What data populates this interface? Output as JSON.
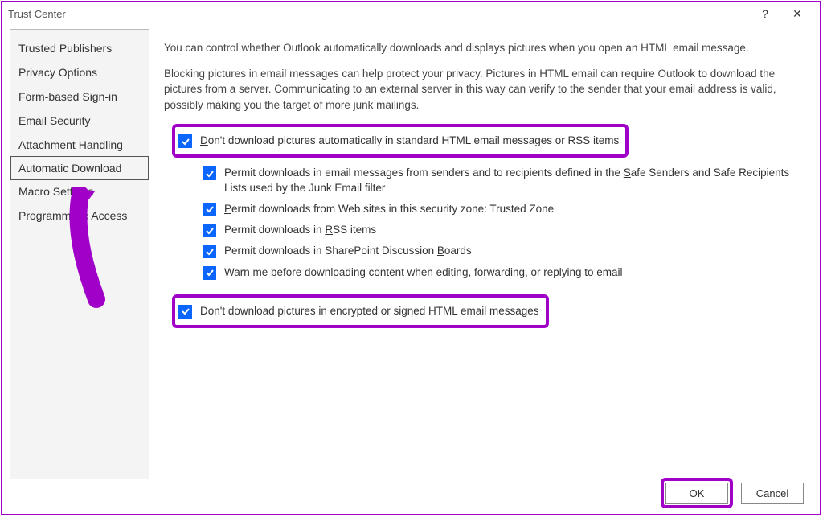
{
  "titlebar": {
    "title": "Trust Center",
    "help": "?",
    "close": "✕"
  },
  "sidebar": {
    "items": [
      {
        "label": "Trusted Publishers"
      },
      {
        "label": "Privacy Options"
      },
      {
        "label": "Form-based Sign-in"
      },
      {
        "label": "Email Security"
      },
      {
        "label": "Attachment Handling"
      },
      {
        "label": "Automatic Download"
      },
      {
        "label": "Macro Settings"
      },
      {
        "label": "Programmatic Access"
      }
    ],
    "selected_index": 5
  },
  "content": {
    "para1": "You can control whether Outlook automatically downloads and displays pictures when you open an HTML email message.",
    "para2": "Blocking pictures in email messages can help protect your privacy. Pictures in HTML email can require Outlook to download the pictures from a server. Communicating to an external server in this way can verify to the sender that your email address is valid, possibly making you the target of more junk mailings.",
    "chk_main": {
      "pre": "D",
      "post": "on't download pictures automatically in standard HTML email messages or RSS items",
      "checked": true
    },
    "sub": [
      {
        "pre": "Permit downloads in email messages from senders and to recipients defined in the ",
        "u": "S",
        "post": "afe Senders and Safe Recipients Lists used by the Junk Email filter",
        "checked": true
      },
      {
        "pre": "",
        "u": "P",
        "post": "ermit downloads from Web sites in this security zone: Trusted Zone",
        "checked": true
      },
      {
        "pre": "Permit downloads in ",
        "u": "R",
        "post": "SS items",
        "checked": true
      },
      {
        "pre": "Permit downloads in SharePoint Discussion ",
        "u": "B",
        "post": "oards",
        "checked": true
      },
      {
        "pre": "",
        "u": "W",
        "post": "arn me before downloading content when editing, forwarding, or replying to email",
        "checked": true
      }
    ],
    "chk_second": {
      "label": "Don't download pictures in encrypted or signed HTML email messages",
      "checked": true
    }
  },
  "footer": {
    "ok": "OK",
    "cancel": "Cancel"
  },
  "colors": {
    "accent": "#a000c8",
    "checkbox": "#0a66ff"
  }
}
